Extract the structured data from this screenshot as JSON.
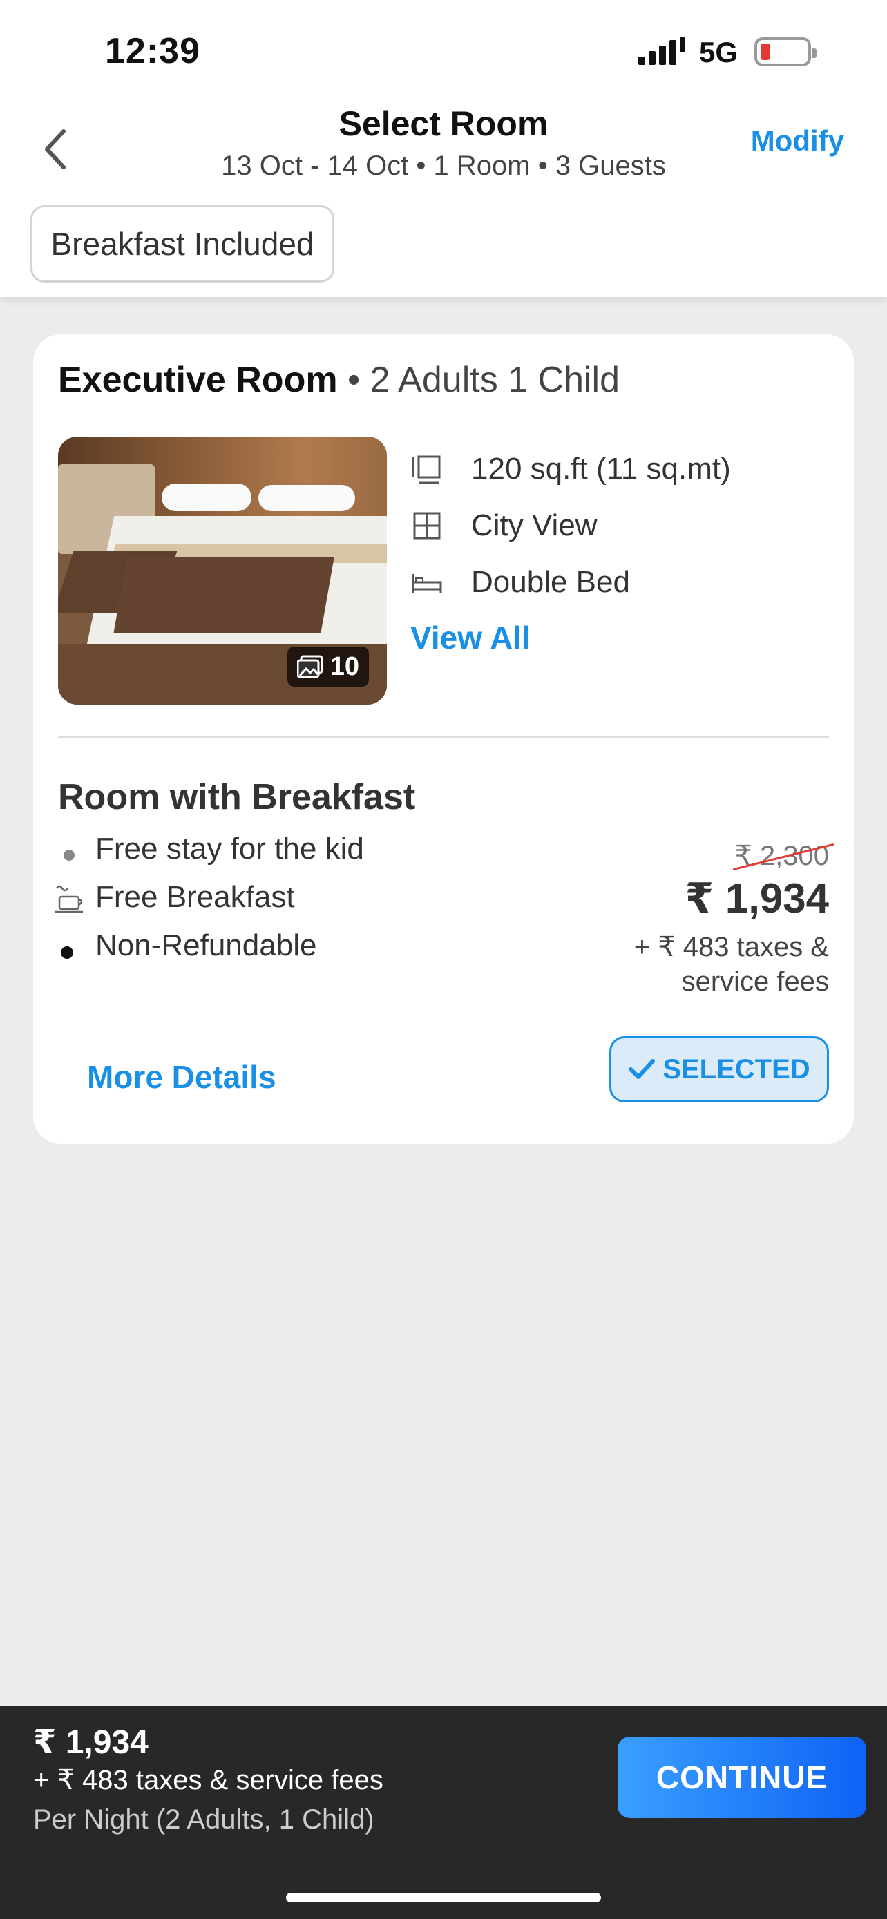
{
  "status_bar": {
    "time": "12:39",
    "network": "5G",
    "battery_color": "#e53935"
  },
  "header": {
    "title": "Select Room",
    "subtitle": "13 Oct - 14 Oct • 1 Room • 3 Guests",
    "modify_label": "Modify",
    "back_icon": "chevron-left-icon"
  },
  "filter_chip": {
    "label": "Breakfast Included"
  },
  "room": {
    "name": "Executive Room",
    "occupancy": "• 2 Adults 1 Child",
    "photo_count": "10",
    "features": [
      {
        "icon": "area-icon",
        "label": "120 sq.ft (11 sq.mt)"
      },
      {
        "icon": "window-icon",
        "label": "City View"
      },
      {
        "icon": "bed-icon",
        "label": "Double Bed"
      }
    ],
    "view_all_label": "View All"
  },
  "plan": {
    "title": "Room with Breakfast",
    "inclusions": [
      {
        "icon": "bullet-dot",
        "label": "Free stay for the kid"
      },
      {
        "icon": "breakfast-icon",
        "label": "Free Breakfast"
      },
      {
        "icon": "bullet-dot",
        "label": "Non-Refundable"
      }
    ],
    "original_price": "₹ 2,300",
    "price": "₹ 1,934",
    "taxes_line1": "+ ₹ 483 taxes &",
    "taxes_line2": "service fees",
    "more_details_label": "More Details",
    "selected_label": "SELECTED"
  },
  "footer": {
    "price": "₹ 1,934",
    "taxes": "+ ₹ 483 taxes & service fees",
    "per_night": "Per Night (2 Adults, 1 Child)",
    "continue_label": "CONTINUE"
  },
  "colors": {
    "accent": "#1a8fe6",
    "selected_bg": "#dcebf9",
    "bottom_bar": "#282828"
  }
}
